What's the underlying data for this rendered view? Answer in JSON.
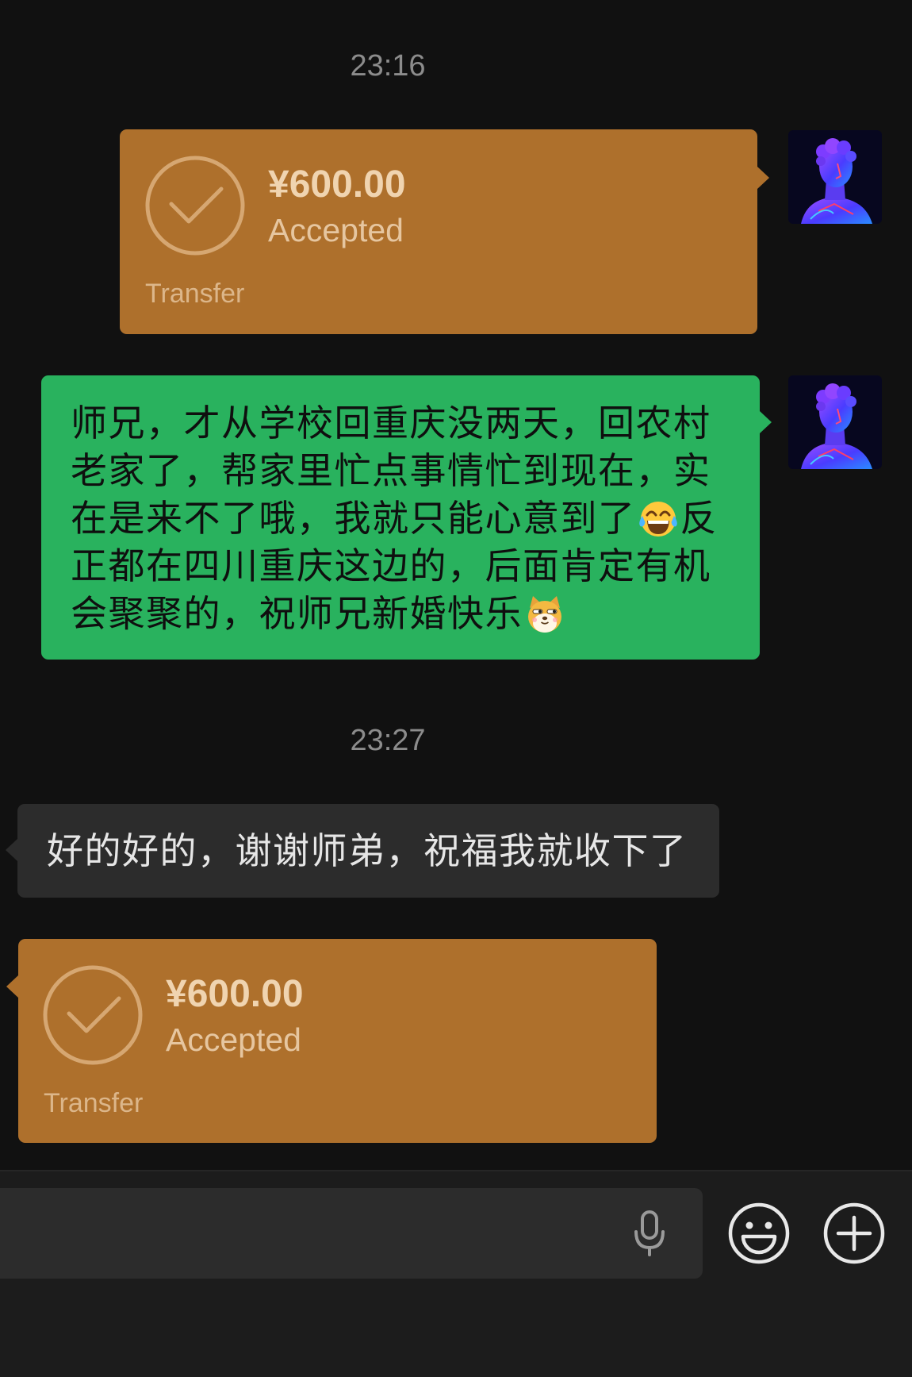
{
  "colors": {
    "chat_background": "#111111",
    "transfer_bubble": "#ae702c",
    "sent_bubble": "#29b25e",
    "received_bubble": "#2c2c2c",
    "input_bar": "#1c1c1c",
    "timestamp_text": "#8c8c8c"
  },
  "chat": {
    "timestamps": [
      "23:16",
      "23:27"
    ],
    "my_avatar_icon": "statue-bust-avatar",
    "transfer_sent": {
      "amount": "¥600.00",
      "status": "Accepted",
      "label": "Transfer",
      "icon": "check-circle-icon"
    },
    "sent_message": {
      "lines": [
        [
          {
            "text": "师兄，才从学校回重庆没两天，回农村"
          }
        ],
        [
          {
            "text": "老家了，帮家里忙点事情忙到现在，实"
          }
        ],
        [
          {
            "text": "在是来不了哦，我就只能心意到了"
          },
          {
            "emoji": "tears-of-joy-emoji"
          },
          {
            "text": "反"
          }
        ],
        [
          {
            "text": "正都在四川重庆这边的，后面肯定有机"
          }
        ],
        [
          {
            "text": "会聚聚的，祝师兄新婚快乐"
          },
          {
            "emoji": "doge-emoji"
          }
        ]
      ]
    },
    "received_message": {
      "text": "好的好的，谢谢师弟，祝福我就收下了"
    },
    "transfer_received": {
      "amount": "¥600.00",
      "status": "Accepted",
      "label": "Transfer",
      "icon": "check-circle-icon"
    }
  },
  "input_bar": {
    "voice_icon": "microphone-icon",
    "emoji_button_icon": "smiley-face-icon",
    "more_button_icon": "plus-circle-icon"
  }
}
